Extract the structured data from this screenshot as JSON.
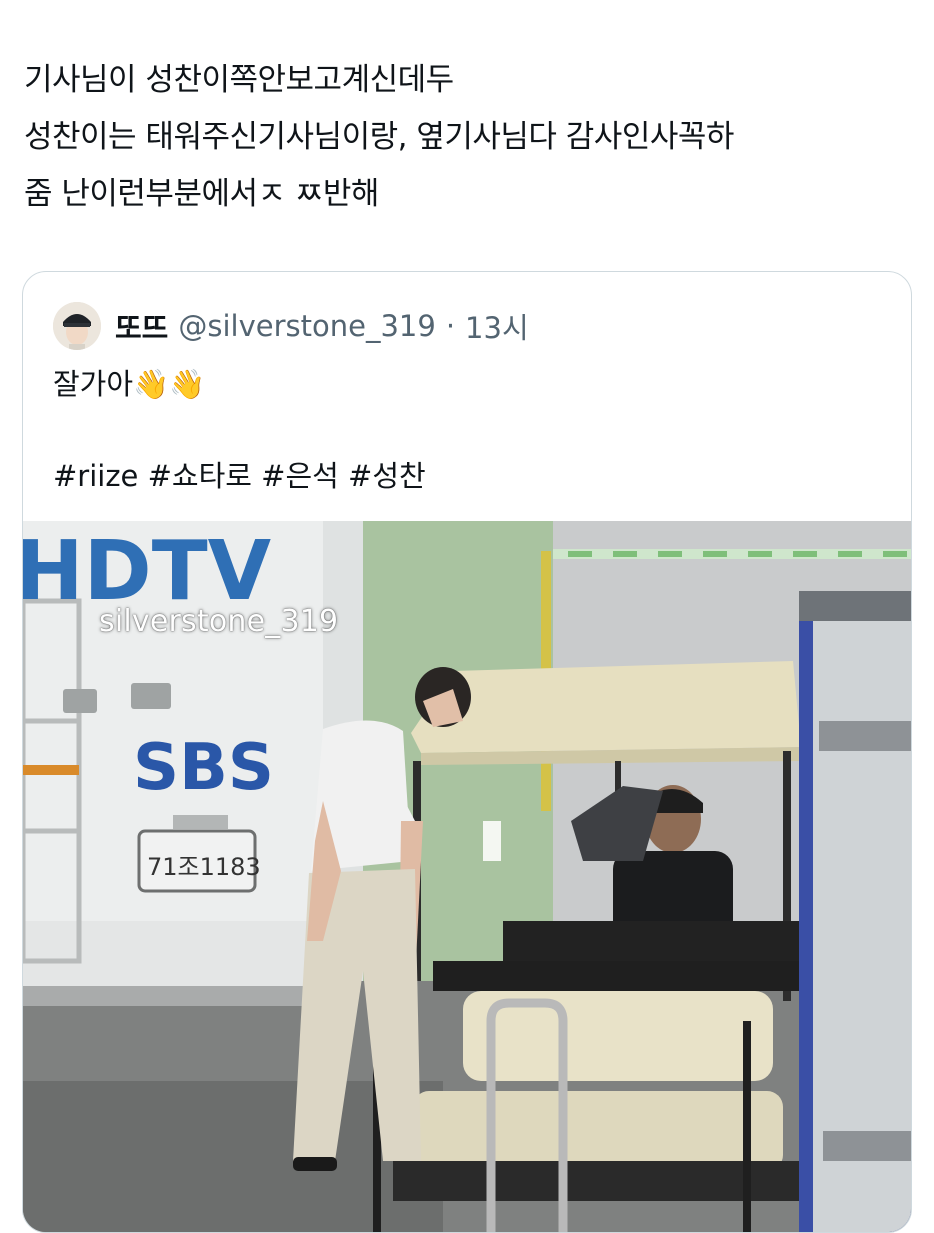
{
  "tweet": {
    "lines": [
      "기사님이 성찬이쪽안보고계신데두",
      "성찬이는 태워주신기사님이랑, 옆기사님다 감사인사꼭하",
      "줌 난이런부분에서ㅈ ㅉ반해"
    ]
  },
  "quoted": {
    "display_name": "또뜨",
    "handle": "@silverstone_319",
    "separator": "·",
    "time": "13시",
    "text": "잘가아",
    "emoji": "👋👋",
    "hashtags": "#riize #쇼타로 #은석 #성찬",
    "media": {
      "watermark": "silverstone_319",
      "van_text": "SBS",
      "truck_text": "HDTV",
      "plate": "71조1183"
    }
  },
  "colors": {
    "text": "#0f1419",
    "muted": "#536471",
    "border": "#cfd9de"
  }
}
